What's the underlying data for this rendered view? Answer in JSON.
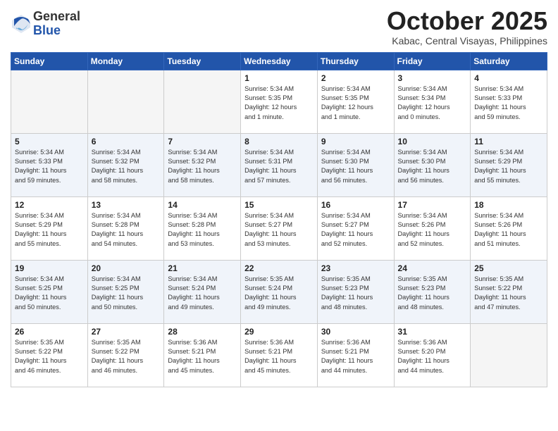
{
  "header": {
    "logo_general": "General",
    "logo_blue": "Blue",
    "month_title": "October 2025",
    "subtitle": "Kabac, Central Visayas, Philippines"
  },
  "days_of_week": [
    "Sunday",
    "Monday",
    "Tuesday",
    "Wednesday",
    "Thursday",
    "Friday",
    "Saturday"
  ],
  "weeks": [
    [
      {
        "day": "",
        "info": ""
      },
      {
        "day": "",
        "info": ""
      },
      {
        "day": "",
        "info": ""
      },
      {
        "day": "1",
        "info": "Sunrise: 5:34 AM\nSunset: 5:35 PM\nDaylight: 12 hours\nand 1 minute."
      },
      {
        "day": "2",
        "info": "Sunrise: 5:34 AM\nSunset: 5:35 PM\nDaylight: 12 hours\nand 1 minute."
      },
      {
        "day": "3",
        "info": "Sunrise: 5:34 AM\nSunset: 5:34 PM\nDaylight: 12 hours\nand 0 minutes."
      },
      {
        "day": "4",
        "info": "Sunrise: 5:34 AM\nSunset: 5:33 PM\nDaylight: 11 hours\nand 59 minutes."
      }
    ],
    [
      {
        "day": "5",
        "info": "Sunrise: 5:34 AM\nSunset: 5:33 PM\nDaylight: 11 hours\nand 59 minutes."
      },
      {
        "day": "6",
        "info": "Sunrise: 5:34 AM\nSunset: 5:32 PM\nDaylight: 11 hours\nand 58 minutes."
      },
      {
        "day": "7",
        "info": "Sunrise: 5:34 AM\nSunset: 5:32 PM\nDaylight: 11 hours\nand 58 minutes."
      },
      {
        "day": "8",
        "info": "Sunrise: 5:34 AM\nSunset: 5:31 PM\nDaylight: 11 hours\nand 57 minutes."
      },
      {
        "day": "9",
        "info": "Sunrise: 5:34 AM\nSunset: 5:30 PM\nDaylight: 11 hours\nand 56 minutes."
      },
      {
        "day": "10",
        "info": "Sunrise: 5:34 AM\nSunset: 5:30 PM\nDaylight: 11 hours\nand 56 minutes."
      },
      {
        "day": "11",
        "info": "Sunrise: 5:34 AM\nSunset: 5:29 PM\nDaylight: 11 hours\nand 55 minutes."
      }
    ],
    [
      {
        "day": "12",
        "info": "Sunrise: 5:34 AM\nSunset: 5:29 PM\nDaylight: 11 hours\nand 55 minutes."
      },
      {
        "day": "13",
        "info": "Sunrise: 5:34 AM\nSunset: 5:28 PM\nDaylight: 11 hours\nand 54 minutes."
      },
      {
        "day": "14",
        "info": "Sunrise: 5:34 AM\nSunset: 5:28 PM\nDaylight: 11 hours\nand 53 minutes."
      },
      {
        "day": "15",
        "info": "Sunrise: 5:34 AM\nSunset: 5:27 PM\nDaylight: 11 hours\nand 53 minutes."
      },
      {
        "day": "16",
        "info": "Sunrise: 5:34 AM\nSunset: 5:27 PM\nDaylight: 11 hours\nand 52 minutes."
      },
      {
        "day": "17",
        "info": "Sunrise: 5:34 AM\nSunset: 5:26 PM\nDaylight: 11 hours\nand 52 minutes."
      },
      {
        "day": "18",
        "info": "Sunrise: 5:34 AM\nSunset: 5:26 PM\nDaylight: 11 hours\nand 51 minutes."
      }
    ],
    [
      {
        "day": "19",
        "info": "Sunrise: 5:34 AM\nSunset: 5:25 PM\nDaylight: 11 hours\nand 50 minutes."
      },
      {
        "day": "20",
        "info": "Sunrise: 5:34 AM\nSunset: 5:25 PM\nDaylight: 11 hours\nand 50 minutes."
      },
      {
        "day": "21",
        "info": "Sunrise: 5:34 AM\nSunset: 5:24 PM\nDaylight: 11 hours\nand 49 minutes."
      },
      {
        "day": "22",
        "info": "Sunrise: 5:35 AM\nSunset: 5:24 PM\nDaylight: 11 hours\nand 49 minutes."
      },
      {
        "day": "23",
        "info": "Sunrise: 5:35 AM\nSunset: 5:23 PM\nDaylight: 11 hours\nand 48 minutes."
      },
      {
        "day": "24",
        "info": "Sunrise: 5:35 AM\nSunset: 5:23 PM\nDaylight: 11 hours\nand 48 minutes."
      },
      {
        "day": "25",
        "info": "Sunrise: 5:35 AM\nSunset: 5:22 PM\nDaylight: 11 hours\nand 47 minutes."
      }
    ],
    [
      {
        "day": "26",
        "info": "Sunrise: 5:35 AM\nSunset: 5:22 PM\nDaylight: 11 hours\nand 46 minutes."
      },
      {
        "day": "27",
        "info": "Sunrise: 5:35 AM\nSunset: 5:22 PM\nDaylight: 11 hours\nand 46 minutes."
      },
      {
        "day": "28",
        "info": "Sunrise: 5:36 AM\nSunset: 5:21 PM\nDaylight: 11 hours\nand 45 minutes."
      },
      {
        "day": "29",
        "info": "Sunrise: 5:36 AM\nSunset: 5:21 PM\nDaylight: 11 hours\nand 45 minutes."
      },
      {
        "day": "30",
        "info": "Sunrise: 5:36 AM\nSunset: 5:21 PM\nDaylight: 11 hours\nand 44 minutes."
      },
      {
        "day": "31",
        "info": "Sunrise: 5:36 AM\nSunset: 5:20 PM\nDaylight: 11 hours\nand 44 minutes."
      },
      {
        "day": "",
        "info": ""
      }
    ]
  ]
}
